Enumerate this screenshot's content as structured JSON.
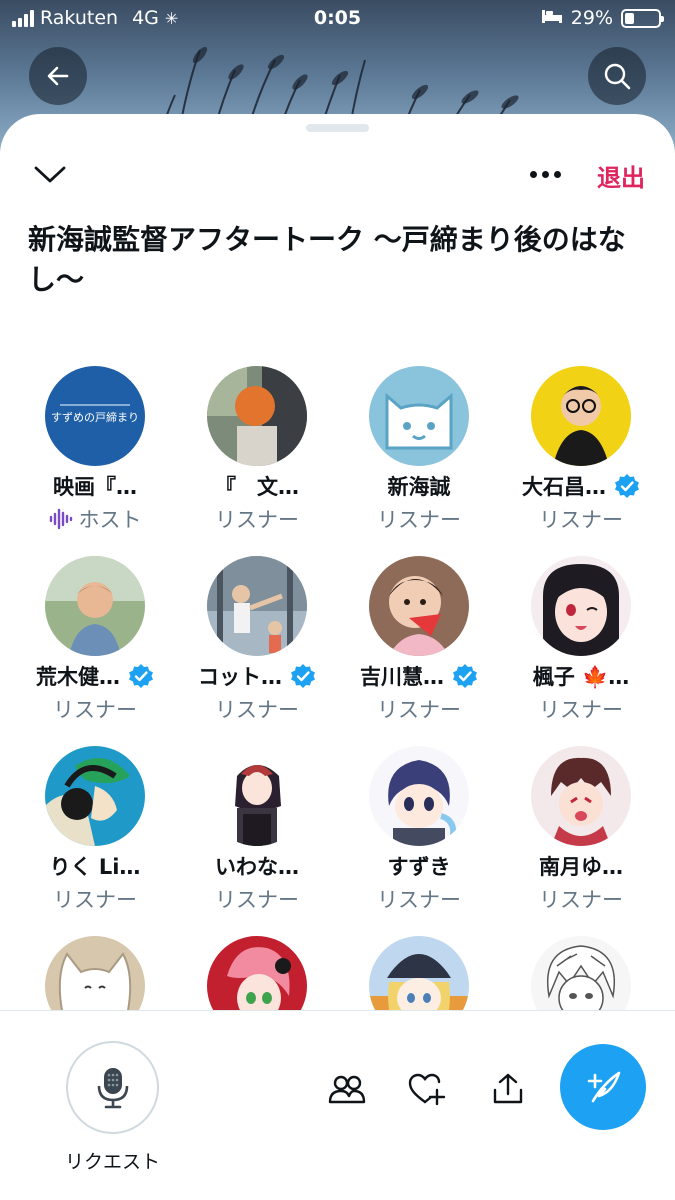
{
  "status_bar": {
    "carrier": "Rakuten",
    "network": "4G",
    "time": "0:05",
    "battery_percent": "29%",
    "battery_level": 0.29
  },
  "nav": {
    "back_icon": "arrow-left-icon",
    "search_icon": "search-icon"
  },
  "sheet": {
    "collapse_icon": "chevron-down-icon",
    "more_icon": "more-horizontal-icon",
    "leave_label": "退出",
    "title": "新海誠監督アフタートーク 〜戸締まり後のはなし〜"
  },
  "participants": [
    {
      "name": "映画『…",
      "role": "ホスト",
      "verified": false,
      "host": true
    },
    {
      "name": "『　文…",
      "role": "リスナー",
      "verified": false
    },
    {
      "name": "新海誠",
      "role": "リスナー",
      "verified": false
    },
    {
      "name": "大石昌…",
      "role": "リスナー",
      "verified": true
    },
    {
      "name": "荒木健…",
      "role": "リスナー",
      "verified": true
    },
    {
      "name": "コット…",
      "role": "リスナー",
      "verified": true
    },
    {
      "name": "吉川慧…",
      "role": "リスナー",
      "verified": true
    },
    {
      "name": "楓子 🍁…",
      "role": "リスナー",
      "verified": false
    },
    {
      "name": "りく Li…",
      "role": "リスナー",
      "verified": false
    },
    {
      "name": "いわな…",
      "role": "リスナー",
      "verified": false
    },
    {
      "name": "すずき",
      "role": "リスナー",
      "verified": false
    },
    {
      "name": "南月ゆ…",
      "role": "リスナー",
      "verified": false
    },
    {
      "name": "",
      "role": "",
      "verified": false
    },
    {
      "name": "",
      "role": "",
      "verified": false
    },
    {
      "name": "",
      "role": "",
      "verified": false
    },
    {
      "name": "",
      "role": "",
      "verified": false
    }
  ],
  "host_avatar_text": "すずめの戸締まり",
  "bottom_bar": {
    "request_label": "リクエスト",
    "mic_icon": "microphone-icon",
    "people_icon": "people-icon",
    "heart_icon": "heart-plus-icon",
    "share_icon": "share-icon",
    "compose_icon": "compose-feather-icon"
  },
  "colors": {
    "accent": "#1da1f2",
    "leave": "#e0245e",
    "secondary_text": "#657786",
    "verified": "#1da1f2"
  }
}
